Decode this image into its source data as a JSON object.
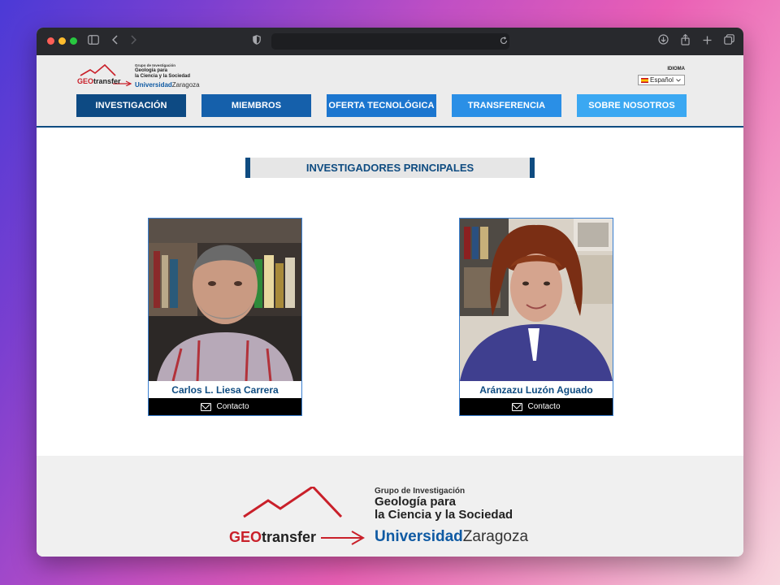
{
  "browser": {
    "icons": [
      "sidebar-icon",
      "back-icon",
      "forward-icon",
      "shield-icon",
      "reload-icon",
      "download-icon",
      "share-icon",
      "new-tab-icon",
      "tabs-icon"
    ]
  },
  "header": {
    "logo": {
      "brand_geo": "GEO",
      "brand_transfer": "transfer",
      "grupo": "Grupo de Investigación",
      "line1": "Geología para",
      "line2": "la Ciencia y la Sociedad",
      "uni_bold": "Universidad",
      "uni_regular": "Zaragoza"
    },
    "idioma_label": "IDIOMA",
    "language": "Español"
  },
  "nav": [
    {
      "label": "INVESTIGACIÓN",
      "color": "#0d4a83"
    },
    {
      "label": "MIEMBROS",
      "color": "#1560ab"
    },
    {
      "label": "OFERTA TECNOLÓGICA",
      "color": "#1c76cf"
    },
    {
      "label": "TRANSFERENCIA",
      "color": "#2a8fe6"
    },
    {
      "label": "SOBRE NOSOTROS",
      "color": "#3ba8f2"
    }
  ],
  "section_title": "INVESTIGADORES PRINCIPALES",
  "researchers": [
    {
      "name": "Carlos L. Liesa Carrera",
      "contact": "Contacto"
    },
    {
      "name": "Aránzazu Luzón Aguado",
      "contact": "Contacto"
    }
  ],
  "footer": {
    "brand_geo": "GEO",
    "brand_transfer": "transfer",
    "grupo": "Grupo de Investigación",
    "line1": "Geología para",
    "line2": "la Ciencia y la Sociedad",
    "uni_bold": "Universidad",
    "uni_regular": "Zaragoza"
  }
}
